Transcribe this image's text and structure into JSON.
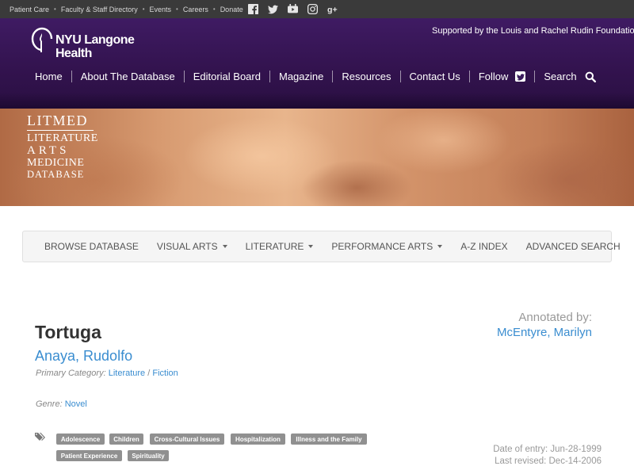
{
  "utility": {
    "links": [
      "Patient Care",
      "Faculty & Staff Directory",
      "Events",
      "Careers",
      "Donate"
    ],
    "separator": "•",
    "social_icons": [
      "facebook-icon",
      "twitter-icon",
      "youtube-icon",
      "instagram-icon",
      "googleplus-icon"
    ]
  },
  "header": {
    "logo_line1": "NYU Langone",
    "logo_line2": "Health",
    "supported_by": "Supported by the Louis and Rachel Rudin Foundation",
    "nav": {
      "home": "Home",
      "about": "About The Database",
      "editorial": "Editorial Board",
      "magazine": "Magazine",
      "resources": "Resources",
      "contact": "Contact Us",
      "follow": "Follow",
      "search": "Search"
    }
  },
  "banner": {
    "line1": "LITMED",
    "line2": "LITERATURE",
    "line3": "ARTS",
    "line4": "MEDICINE",
    "line5": "DATABASE"
  },
  "subnav": {
    "browse": "BROWSE DATABASE",
    "visual": "VISUAL ARTS",
    "literature": "LITERATURE",
    "performance": "PERFORMANCE ARTS",
    "az": "A-Z INDEX",
    "advanced": "ADVANCED SEARCH"
  },
  "record": {
    "title": "Tortuga",
    "author": "Anaya, Rudolfo",
    "primary_category_label": "Primary Category:",
    "primary_category_1": "Literature",
    "primary_category_sep": "/",
    "primary_category_2": "Fiction",
    "genre_label": "Genre:",
    "genre": "Novel",
    "annotated_by_label": "Annotated by:",
    "annotator": "McEntyre, Marilyn",
    "tags": [
      "Adolescence",
      "Children",
      "Cross-Cultural Issues",
      "Hospitalization",
      "Illness and the Family",
      "Patient Experience",
      "Spirituality"
    ],
    "date_of_entry": "Date of entry: Jun-28-1999",
    "last_revised": "Last revised: Dec-14-2006"
  }
}
